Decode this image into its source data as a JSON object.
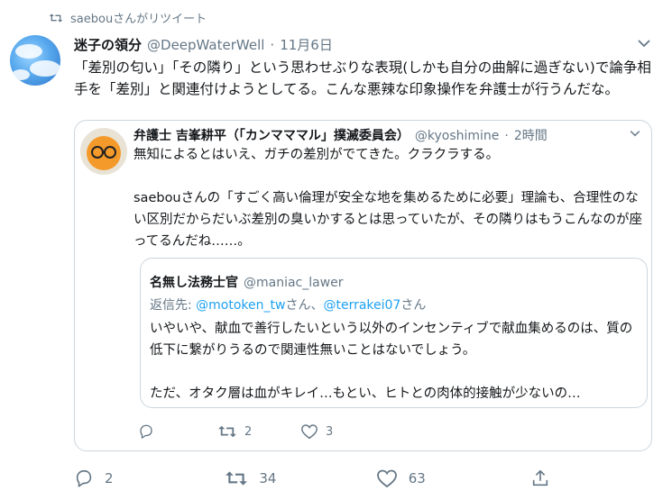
{
  "retweet": {
    "text": "saebouさんがリツイート",
    "icon": "retweet-icon"
  },
  "tweet": {
    "name": "迷子の領分",
    "handle": "@DeepWaterWell",
    "separator": "·",
    "time": "11月6日",
    "text": "「差別の匂い」「その隣り」という思わせぶりな表現(しかも自分の曲解に過ぎない)で論争相手を「差別」と関連付けようとしてる。こんな悪辣な印象操作を弁護士が行うんだな。"
  },
  "quote": {
    "name": "弁護士 吉峯耕平（「カンマママル」撲滅委員会）",
    "handle": "@kyoshimine",
    "separator": "·",
    "time": "2時間",
    "line1": "無知によるとはいえ、ガチの差別がでてきた。クラクラする。",
    "line2": "saebouさんの「すごく高い倫理が安全な地を集めるために必要」理論も、合理性のない区別だからだいぶ差別の臭いかするとは思っていたが、その隣りはもうこんなのが座ってるんだね……。",
    "nested": {
      "name": "名無し法務士官",
      "handle": "@maniac_lawer",
      "reply_prefix": "返信先: ",
      "reply_user1": "@motoken_tw",
      "reply_mid": "さん、",
      "reply_user2": "@terrakei07",
      "reply_suffix": "さん",
      "line1": "いやいや、献血で善行したいという以外のインセンティブで献血集めるのは、質の低下に繋がりうるので関連性無いことはないでしょう。",
      "line2": "ただ、オタク層は血がキレイ…もとい、ヒトとの肉体的接触が少ないの…"
    },
    "actions": {
      "reply_count": "",
      "retweet_count": "2",
      "like_count": "3"
    }
  },
  "actions": {
    "reply_count": "2",
    "retweet_count": "34",
    "like_count": "63",
    "share_count": ""
  },
  "colors": {
    "accent": "#1da1f2",
    "secondary_text": "#657786",
    "border": "#ccd6dd"
  }
}
